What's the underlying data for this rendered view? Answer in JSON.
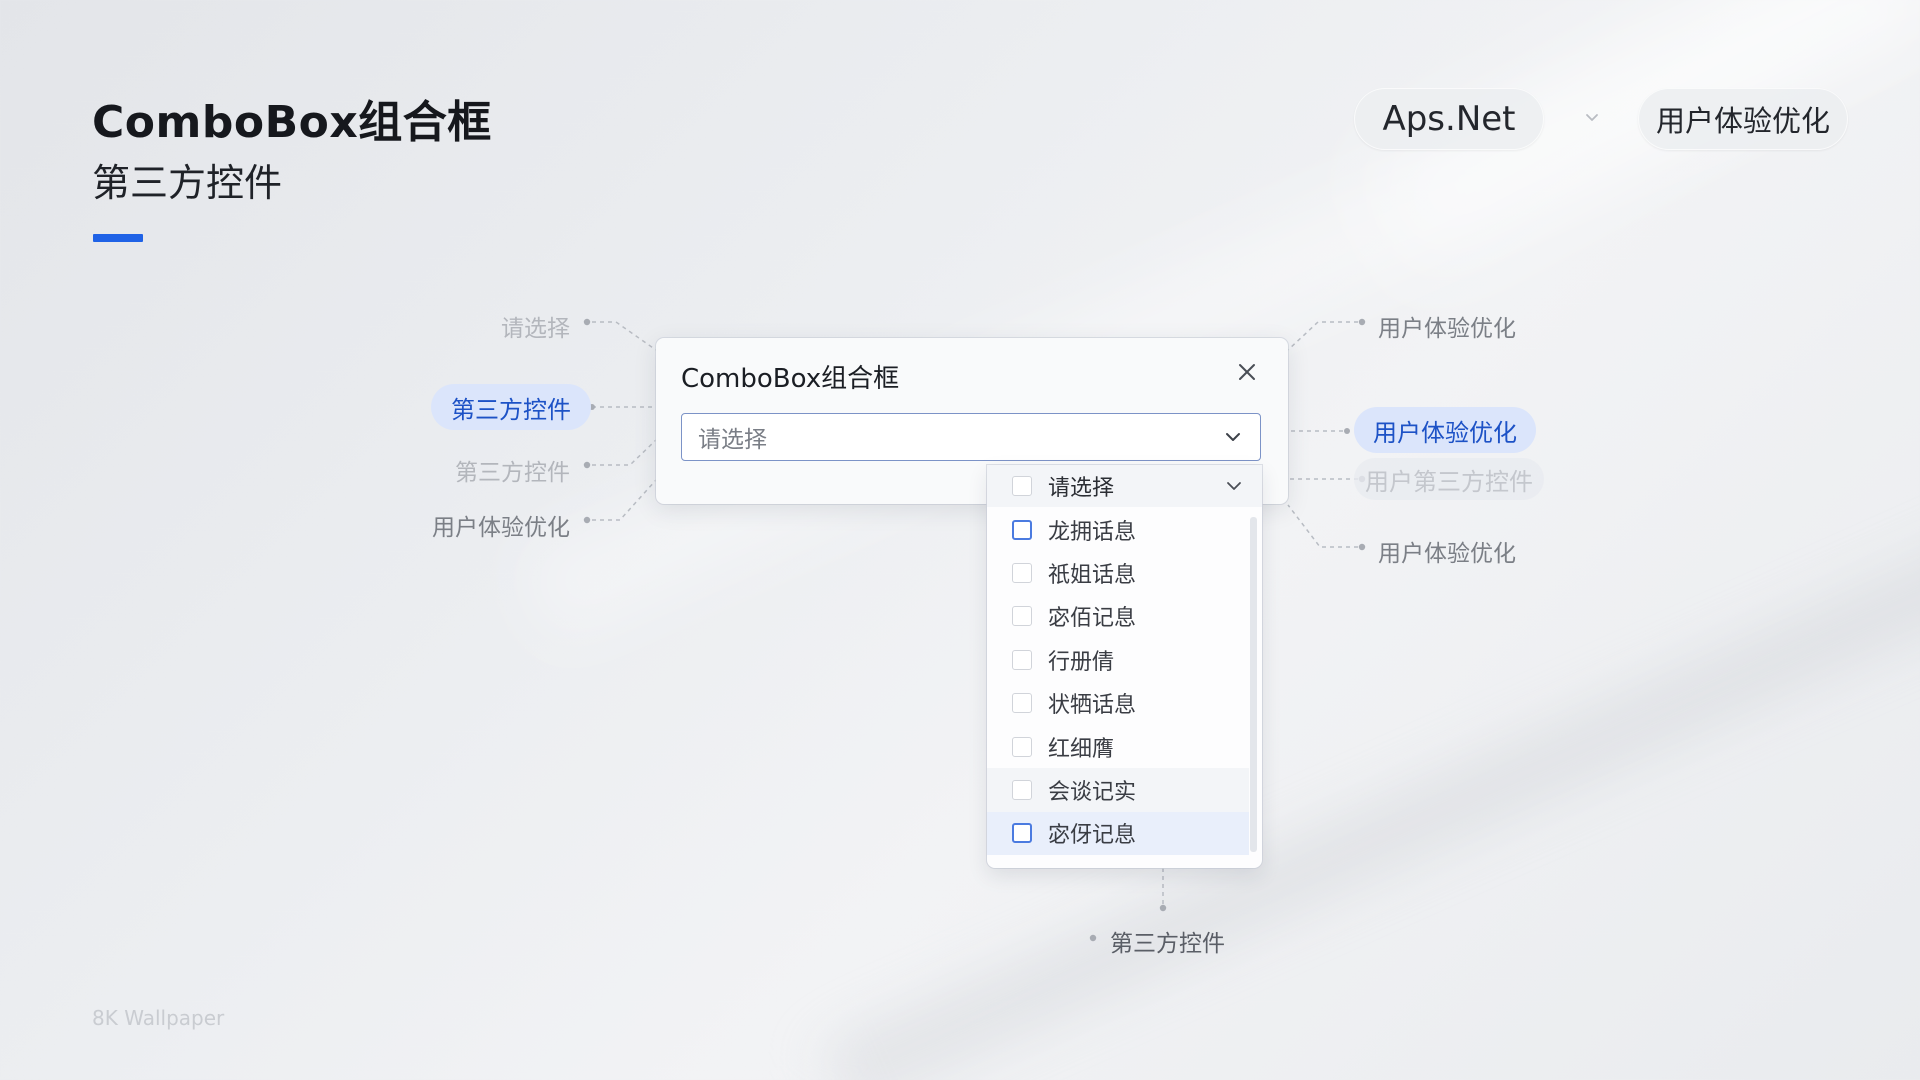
{
  "header": {
    "title": "ComboBox组合框",
    "subtitle": "第三方控件",
    "accent_color": "#1f62e6"
  },
  "top_nav": {
    "framework_label": "Aps.Net",
    "topic_label": "用户体验优化",
    "chevron_icon": "chevron-down-icon"
  },
  "left_labels": {
    "item1": "请选择",
    "item2_chip": "第三方控件",
    "item3": "第三方控件",
    "item4": "用户体验优化"
  },
  "right_labels": {
    "item1": "用户体验优化",
    "item2_chip": "用户体验优化",
    "item3_chip": "用户第三方控件",
    "item4": "用户体验优化"
  },
  "bottom_label": "第三方控件",
  "dialog": {
    "title": "ComboBox组合框",
    "close_icon": "close-icon",
    "input_value": "请选择",
    "input_icon": "chevron-down-icon"
  },
  "dropdown": {
    "header_label": "请选择",
    "items": [
      {
        "label": "龙拥话息",
        "state": "outlined"
      },
      {
        "label": "祇姐话息",
        "state": "default"
      },
      {
        "label": "宓佰记息",
        "state": "default"
      },
      {
        "label": "行册倩",
        "state": "default"
      },
      {
        "label": "状牺话息",
        "state": "default"
      },
      {
        "label": "红细膺",
        "state": "default"
      },
      {
        "label": "会谈记实",
        "state": "hover"
      },
      {
        "label": "宓伢记息",
        "state": "selected"
      }
    ]
  },
  "watermark": "8K Wallpaper"
}
